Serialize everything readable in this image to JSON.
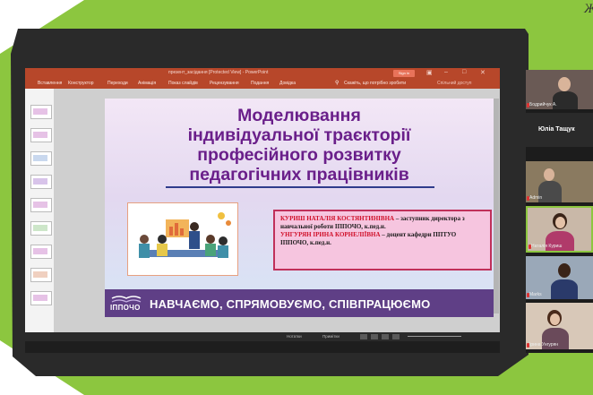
{
  "corner_text": "Ж",
  "app": {
    "window_title": "презент_засідання [Protected View] - PowerPoint",
    "signin_button": "Sign in",
    "ribbon_tabs": [
      "Вставлення",
      "Конструктор",
      "Переходи",
      "Анімація",
      "Показ слайдів",
      "Рецензування",
      "Подання",
      "Довідка"
    ],
    "search_hint": "Скажіть, що потрібно зробити",
    "ribbon_right": "Спільний доступ"
  },
  "slide": {
    "title_lines": [
      "Моделювання",
      "індивідуальної траєкторії",
      "професійного розвитку",
      "педагогічних працівників"
    ],
    "speakers": [
      {
        "name": "КУРИШ НАТАЛІЯ КОСТЯНТИНІВНА",
        "role": "заступник директора з навчальної роботи ІППОЧО, к.пед.н."
      },
      {
        "name": "УНГУРЯН ІРИНА КОРНЕЛІЇВНА",
        "role": "доцент кафедри ППТУО ІППОЧО, к.пед.н."
      }
    ],
    "logo_text": "ІППОЧО",
    "motto": "НАВЧАЄМО, СПРЯМОВУЄМО, СПІВПРАЦЮЄМО"
  },
  "statusbar": {
    "notes": "Нотатки",
    "comments": "Примітки"
  },
  "participants": [
    {
      "name": "Бодрийчук А."
    },
    {
      "name": "Юліа Тащук"
    },
    {
      "name": "Admin"
    },
    {
      "name": "Наталія Куриш"
    },
    {
      "name": "Marks"
    },
    {
      "name": "Ірина Унгурян"
    }
  ],
  "colors": {
    "frame_green": "#8cc63f",
    "ppt_accent": "#b7472a",
    "slide_title": "#6a1f8a",
    "banner": "#5f3f86"
  }
}
